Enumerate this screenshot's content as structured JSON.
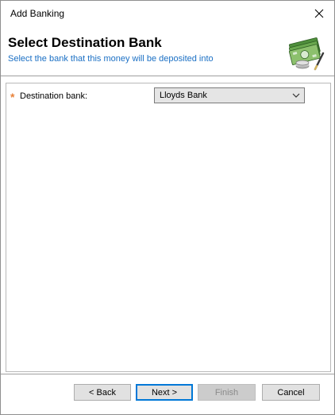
{
  "window": {
    "title": "Add Banking"
  },
  "header": {
    "title": "Select Destination Bank",
    "subtitle": "Select the bank that this money will be deposited into",
    "icon": "money-icon"
  },
  "form": {
    "required_marker": "*",
    "destination_bank_label": "Destination bank:",
    "destination_bank_value": "Lloyds Bank"
  },
  "buttons": {
    "back": "< Back",
    "next": "Next >",
    "finish": "Finish",
    "cancel": "Cancel"
  },
  "colors": {
    "subtitle": "#1a6fc4",
    "required": "#e8823a",
    "default_button_border": "#0078d7"
  }
}
